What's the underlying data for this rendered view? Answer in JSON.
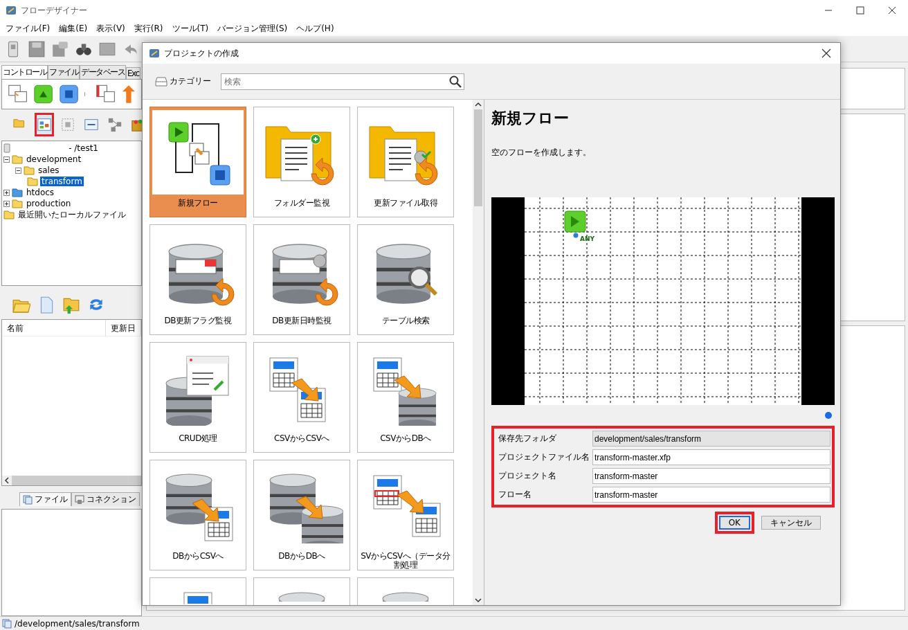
{
  "window": {
    "title": "フローデザイナー"
  },
  "menu": [
    "ファイル(F)",
    "編集(E)",
    "表示(V)",
    "実行(R)",
    "ツール(T)",
    "バージョン管理(S)",
    "ヘルプ(H)"
  ],
  "toolbar": [
    {
      "kind": "device"
    },
    {
      "kind": "save"
    },
    {
      "kind": "save-as"
    },
    {
      "kind": "binoculars"
    },
    {
      "kind": "grey-block"
    },
    {
      "kind": "undo"
    }
  ],
  "left_panel": {
    "tabs": [
      {
        "label": "コントロール",
        "selected": true
      },
      {
        "label": "ファイル",
        "selected": false
      },
      {
        "label": "データベース",
        "selected": false
      },
      {
        "label": "Exc",
        "selected": false
      }
    ],
    "palette": [
      {
        "kind": "table-arrow"
      },
      {
        "kind": "start"
      },
      {
        "kind": "stop"
      },
      {
        "kind": "sep"
      },
      {
        "kind": "table-arrow2"
      },
      {
        "kind": "orange-arrows"
      }
    ],
    "tree_toolbar": [
      {
        "kind": "folder",
        "highlighted": false
      },
      {
        "kind": "project",
        "highlighted": true
      },
      {
        "kind": "dashed",
        "highlighted": false
      },
      {
        "kind": "link",
        "highlighted": false
      },
      {
        "kind": "nodes",
        "highlighted": false
      },
      {
        "kind": "box",
        "highlighted": false
      }
    ],
    "tree": {
      "root": "- /test1",
      "items": [
        {
          "label": "development",
          "kind": "folder",
          "expanded": true,
          "selected": false,
          "children": [
            {
              "label": "sales",
              "kind": "folder",
              "expanded": true,
              "selected": false,
              "children": [
                {
                  "label": "transform",
                  "kind": "folder",
                  "selected": true
                }
              ]
            }
          ]
        },
        {
          "label": "htdocs",
          "kind": "blue-folder",
          "expanded": false,
          "selected": false
        },
        {
          "label": "production",
          "kind": "folder",
          "expanded": false,
          "selected": false
        },
        {
          "label": "最近開いたローカルファイル",
          "kind": "folder",
          "selected": false
        }
      ]
    },
    "file_toolbar": [
      {
        "kind": "open-folder"
      },
      {
        "kind": "new-file"
      },
      {
        "kind": "upload-folder"
      },
      {
        "kind": "refresh"
      }
    ],
    "file_table": {
      "columns": [
        "名前",
        "更新日"
      ]
    },
    "bottom_tabs": [
      {
        "label": "ファイル",
        "selected": true
      },
      {
        "label": "コネクション",
        "selected": false
      }
    ]
  },
  "status_bar": "/development/sales/transform",
  "dialog": {
    "title": "プロジェクトの作成",
    "category": "カテゴリー",
    "search": {
      "placeholder": "検索"
    },
    "templates": [
      {
        "label": "新規フロー",
        "kind": "flow",
        "selected": true
      },
      {
        "label": "フォルダー監視",
        "kind": "folder-watch",
        "selected": false
      },
      {
        "label": "更新ファイル取得",
        "kind": "file-fetch",
        "selected": false
      },
      {
        "label": "DB更新フラグ監視",
        "kind": "db-flag",
        "selected": false
      },
      {
        "label": "DB更新日時監視",
        "kind": "db-time",
        "selected": false
      },
      {
        "label": "テーブル検索",
        "kind": "db-search",
        "selected": false
      },
      {
        "label": "CRUD処理",
        "kind": "crud",
        "selected": false
      },
      {
        "label": "CSVからCSVへ",
        "kind": "csv-csv",
        "selected": false
      },
      {
        "label": "CSVからDBへ",
        "kind": "csv-db",
        "selected": false
      },
      {
        "label": "DBからCSVへ",
        "kind": "db-csv",
        "selected": false
      },
      {
        "label": "DBからDBへ",
        "kind": "db-db",
        "selected": false
      },
      {
        "label": "SVからCSVへ（データ分割処理",
        "kind": "csv-split",
        "selected": false
      },
      {
        "kind": "csv-top",
        "selected": false
      },
      {
        "kind": "db-top",
        "selected": false
      },
      {
        "kind": "db-top",
        "selected": false
      }
    ],
    "detail": {
      "title": "新規フロー",
      "description": "空のフローを作成します。",
      "preview_label": "ANY"
    },
    "pager": [
      {
        "selected": true
      }
    ],
    "form": {
      "highlighted": true,
      "rows": [
        {
          "label": "保存先フォルダ",
          "value": "development/sales/transform",
          "readonly": true
        },
        {
          "label": "プロジェクトファイル名",
          "value": "transform-master.xfp",
          "readonly": false
        },
        {
          "label": "プロジェクト名",
          "value": "transform-master",
          "readonly": false
        },
        {
          "label": "フロー名",
          "value": "transform-master",
          "readonly": false
        }
      ]
    },
    "buttons": [
      {
        "label": "OK",
        "kind": "primary",
        "highlighted": true
      },
      {
        "label": "キャンセル",
        "kind": "normal",
        "highlighted": false
      }
    ]
  }
}
